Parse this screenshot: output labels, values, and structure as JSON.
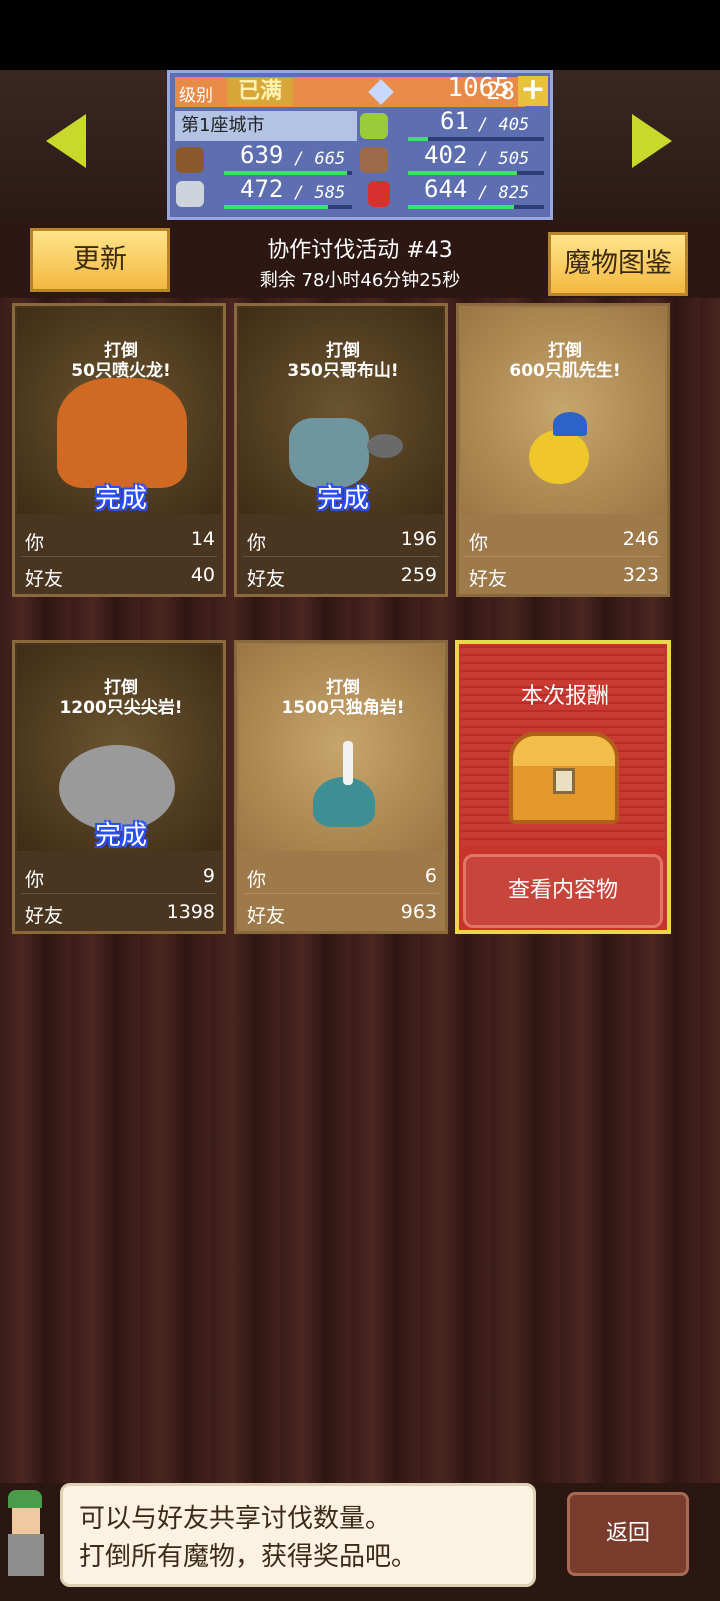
{
  "header": {
    "level_label": "级别",
    "level_max_badge": "已满",
    "level_value": "28",
    "gems": "1065",
    "city_name": "第1座城市",
    "resources": [
      {
        "icon": "wood-log-icon",
        "value": "639",
        "max": "/ 665",
        "fill": 0.96
      },
      {
        "icon": "grass-icon",
        "value": "61",
        "max": "/ 405",
        "fill": 0.15
      },
      {
        "icon": "stone-ore-icon",
        "value": "472",
        "max": "/ 585",
        "fill": 0.81
      },
      {
        "icon": "food-basket-icon",
        "value": "402",
        "max": "/ 505",
        "fill": 0.8
      },
      {
        "icon": "red-crystal-icon",
        "value": "644",
        "max": "/ 825",
        "fill": 0.78
      }
    ]
  },
  "event": {
    "update_label": "更新",
    "bestiary_label": "魔物图鉴",
    "title": "协作讨伐活动 #43",
    "timer": "剩余 78小时46分钟25秒"
  },
  "cards": [
    {
      "line1": "打倒",
      "line2": "50只喷火龙!",
      "done": "完成",
      "you_label": "你",
      "you": "14",
      "friend_label": "好友",
      "friend": "40",
      "monster": "fire-dragon",
      "color": "#d06a22"
    },
    {
      "line1": "打倒",
      "line2": "350只哥布山!",
      "done": "完成",
      "you_label": "你",
      "you": "196",
      "friend_label": "好友",
      "friend": "259",
      "monster": "goblin",
      "color": "#6f95a0"
    },
    {
      "line1": "打倒",
      "line2": "600只肌先生!",
      "done": "",
      "you_label": "你",
      "you": "246",
      "friend_label": "好友",
      "friend": "323",
      "monster": "yellow-bird",
      "color": "#f0c72a"
    },
    {
      "line1": "打倒",
      "line2": "1200只尖尖岩!",
      "done": "完成",
      "you_label": "你",
      "you": "9",
      "friend_label": "好友",
      "friend": "1398",
      "monster": "spiked-rock",
      "color": "#9a9a9a"
    },
    {
      "line1": "打倒",
      "line2": "1500只独角岩!",
      "done": "",
      "you_label": "你",
      "you": "6",
      "friend_label": "好友",
      "friend": "963",
      "monster": "horned-slime",
      "color": "#3e8f94"
    }
  ],
  "reward": {
    "title": "本次报酬",
    "view_button": "查看内容物"
  },
  "footer": {
    "tip_line1": "可以与好友共享讨伐数量。",
    "tip_line2": "打倒所有魔物，获得奖品吧。",
    "back_label": "返回"
  },
  "colors": {
    "accent_yellow": "#c7d92a",
    "panel_blue": "#5d6fb1",
    "done_text_glow": "#2a4fff",
    "reward_red": "#c8342c"
  }
}
